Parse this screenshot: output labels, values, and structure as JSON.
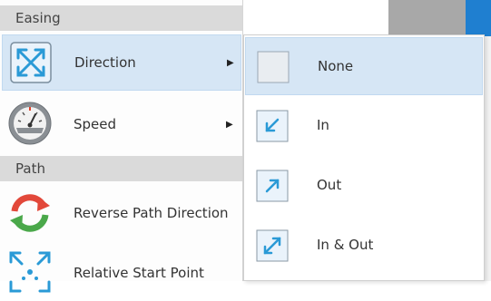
{
  "menu": {
    "sections": {
      "easing": "Easing",
      "path": "Path"
    },
    "items": {
      "direction": {
        "label": "Direction",
        "icon": "direction-expand-icon",
        "has_submenu": true
      },
      "speed": {
        "label": "Speed",
        "icon": "speedometer-icon",
        "has_submenu": true
      },
      "reverse": {
        "label": "Reverse Path Direction",
        "icon": "reverse-arrows-icon"
      },
      "relative": {
        "label": "Relative Start Point",
        "icon": "relative-start-icon"
      }
    },
    "submenu_arrow": "▶"
  },
  "submenu": {
    "items": {
      "none": {
        "label": "None",
        "icon": "none-box-icon"
      },
      "in": {
        "label": "In",
        "icon": "arrow-in-icon"
      },
      "out": {
        "label": "Out",
        "icon": "arrow-out-icon"
      },
      "inout": {
        "label": "In & Out",
        "icon": "arrow-in-out-icon"
      }
    }
  },
  "colors": {
    "hover_bg": "#d6e6f5",
    "section_bg": "#dadada",
    "accent_blue": "#1f7fd0"
  }
}
